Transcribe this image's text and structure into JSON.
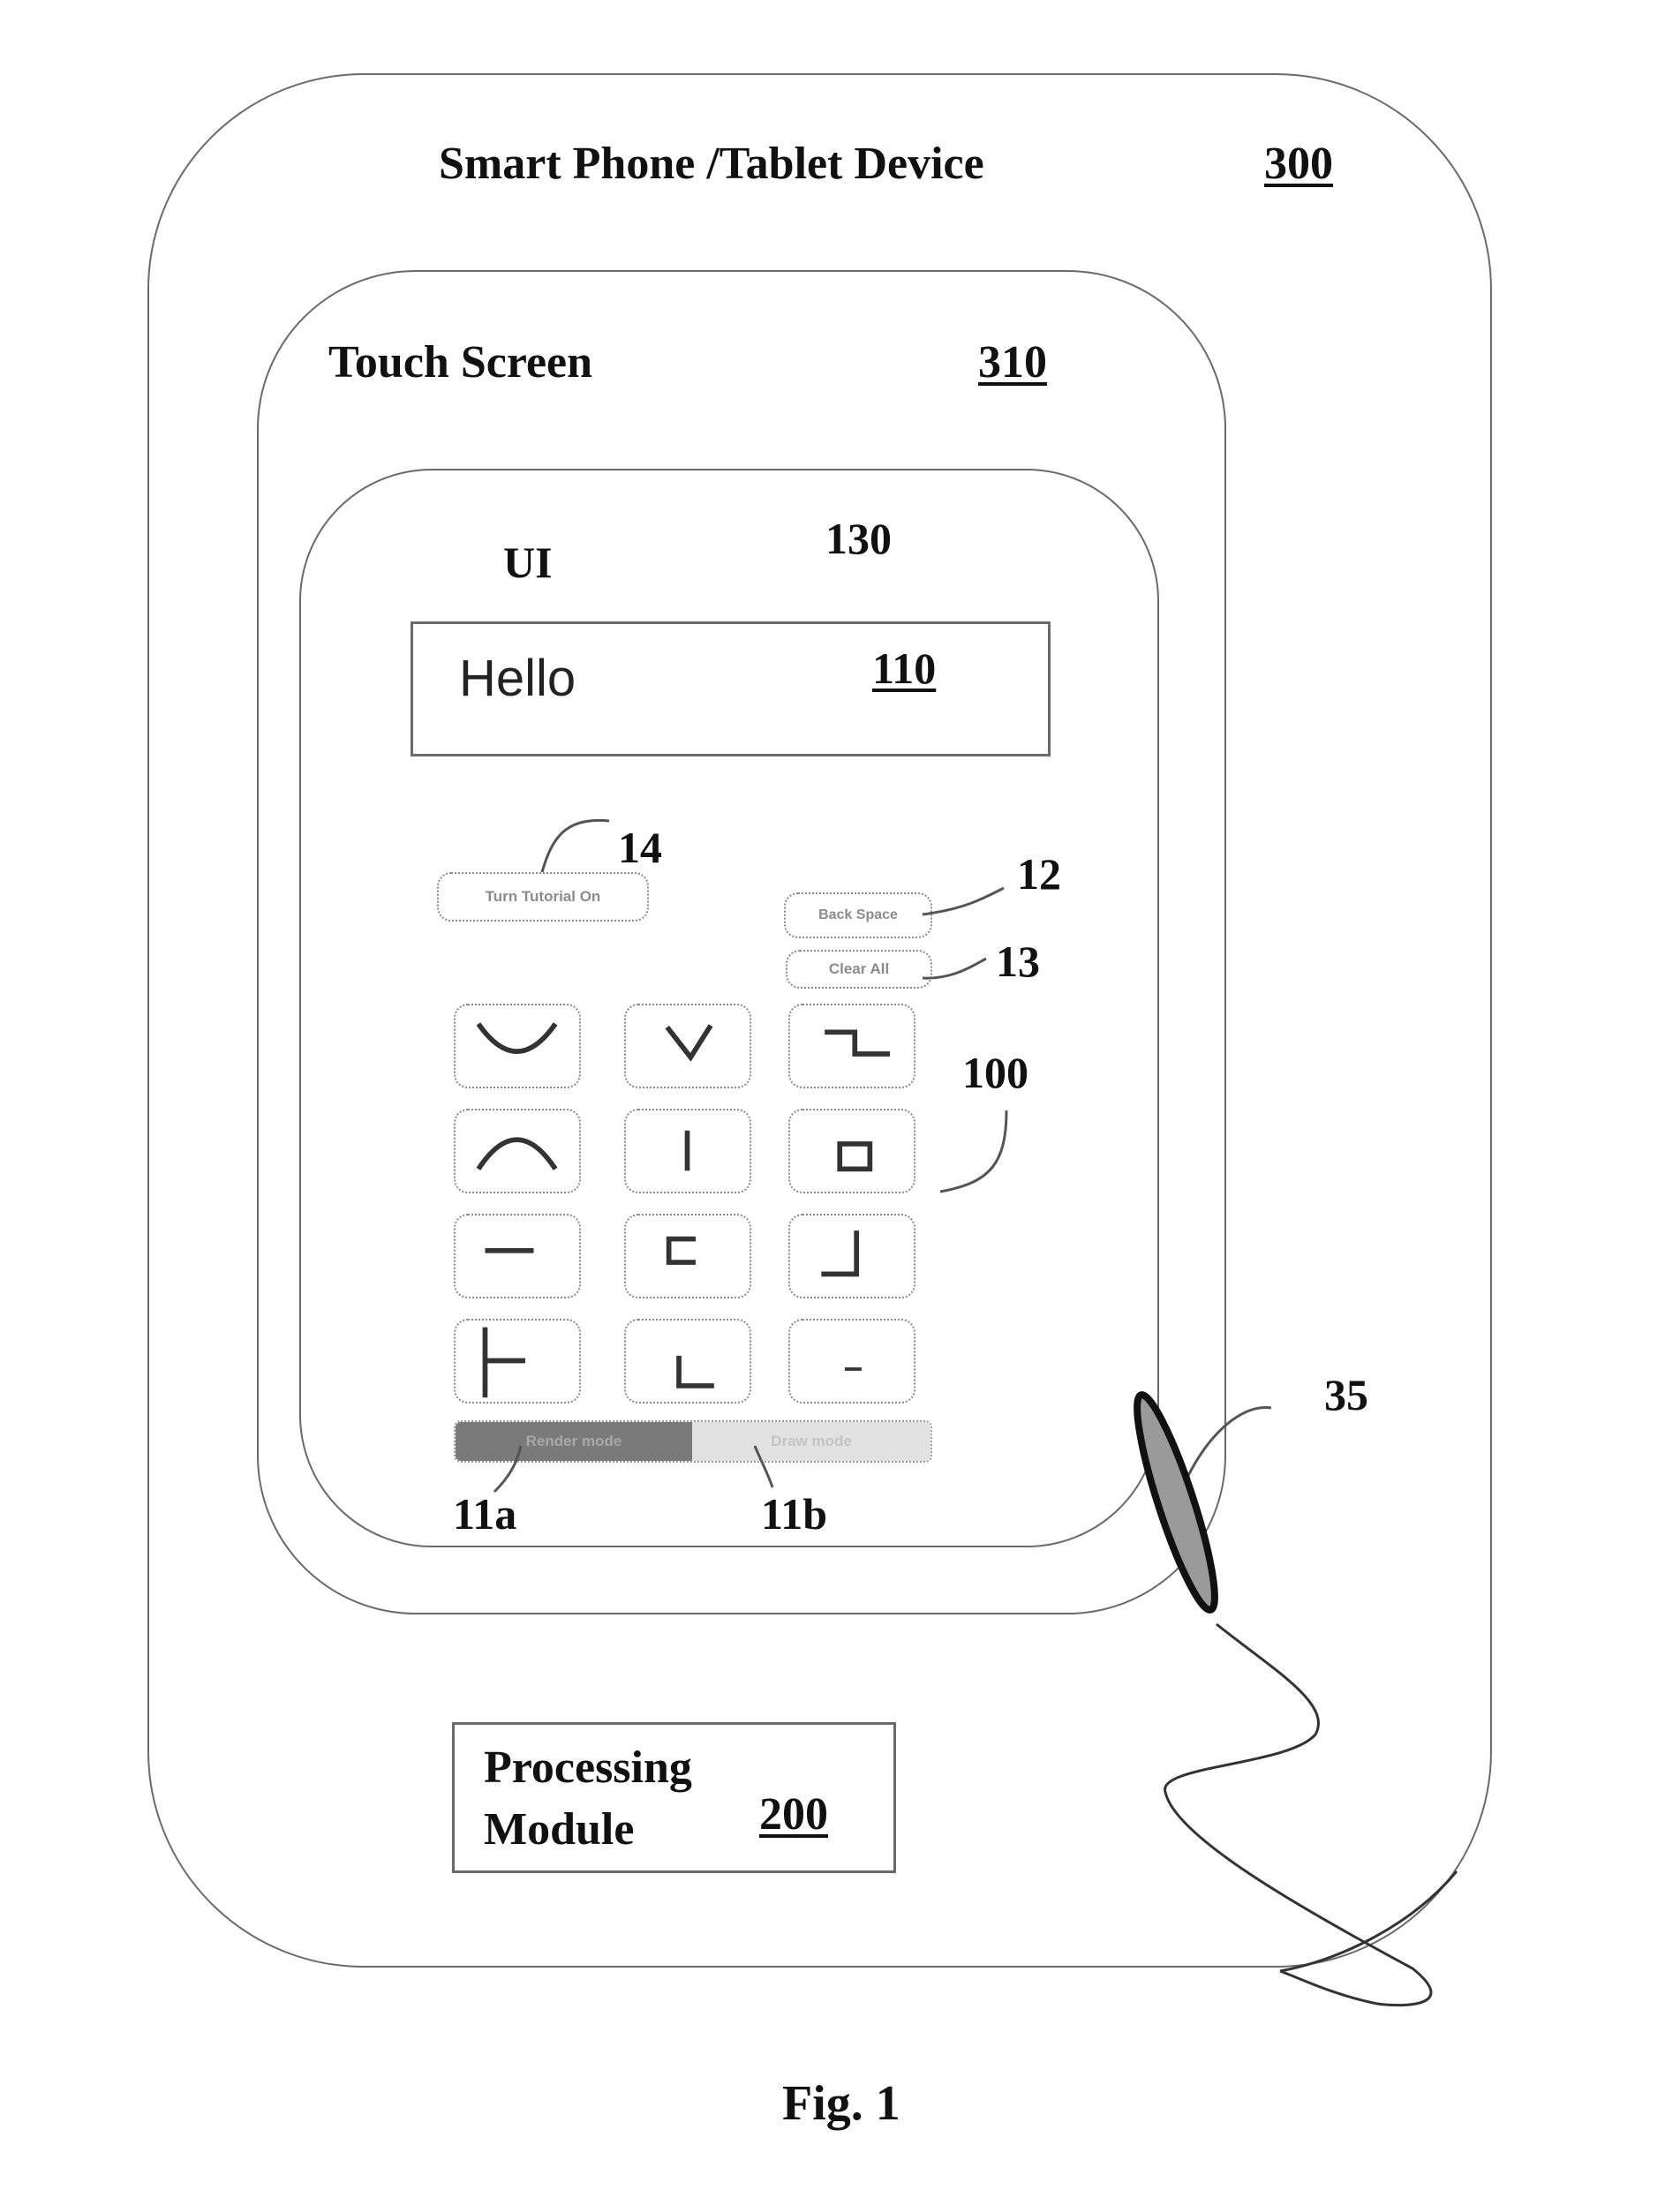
{
  "device": {
    "title": "Smart Phone /Tablet Device",
    "ref": "300"
  },
  "touch_screen": {
    "title": "Touch Screen",
    "ref": "310"
  },
  "ui": {
    "title": "UI",
    "ref": "130"
  },
  "text_field": {
    "value": "Hello",
    "ref": "110"
  },
  "buttons": {
    "tutorial": {
      "label": "Turn Tutorial On",
      "ref": "14"
    },
    "backspace": {
      "label": "Back Space",
      "ref": "12"
    },
    "clear_all": {
      "label": "Clear All",
      "ref": "13"
    }
  },
  "gesture_grid": {
    "ref": "100",
    "keys": [
      {
        "icon": "u-curve-icon"
      },
      {
        "icon": "v-shape-icon"
      },
      {
        "icon": "step-down-icon"
      },
      {
        "icon": "arch-icon"
      },
      {
        "icon": "vertical-line-icon"
      },
      {
        "icon": "small-square-icon"
      },
      {
        "icon": "horizontal-line-icon"
      },
      {
        "icon": "bracket-icon"
      },
      {
        "icon": "j-hook-icon"
      },
      {
        "icon": "t-side-icon"
      },
      {
        "icon": "l-corner-icon"
      },
      {
        "icon": "dash-icon"
      }
    ]
  },
  "mode_toggle": {
    "render": {
      "label": "Render mode",
      "ref": "11a",
      "active": true
    },
    "draw": {
      "label": "Draw mode",
      "ref": "11b",
      "active": false
    }
  },
  "stylus": {
    "ref": "35"
  },
  "processing": {
    "line1": "Processing",
    "line2": "Module",
    "ref": "200"
  },
  "figure_caption": "Fig. 1",
  "colors": {
    "outline": "#6a6a6a",
    "render_mode_fill": "#7a7a7a",
    "draw_mode_fill": "#dcdcdc",
    "stylus_fill": "#9a9a9a"
  }
}
